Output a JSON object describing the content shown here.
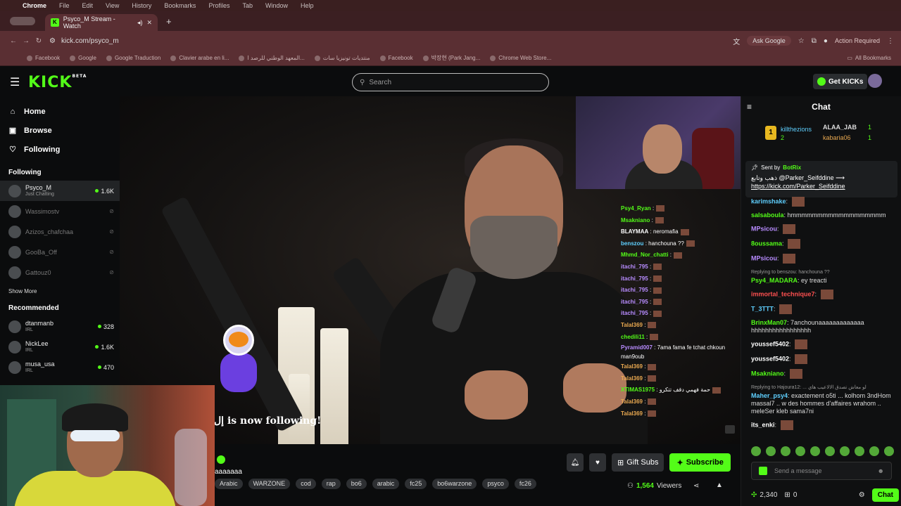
{
  "mac_menu": {
    "apple": "",
    "items": [
      "Chrome",
      "File",
      "Edit",
      "View",
      "History",
      "Bookmarks",
      "Profiles",
      "Tab",
      "Window",
      "Help"
    ]
  },
  "browser": {
    "tab_title": "Psyco_M Stream - Watch",
    "new_tab": "+",
    "url": "kick.com/psyco_m",
    "ask_google": "Ask Google",
    "action_required": "Action Required",
    "bookmarks": [
      "Facebook",
      "Google",
      "Google Traduction",
      "Clavier arabe en li...",
      "المعهد الوطني للرصد ا...",
      "منتديات تونيزيا سات",
      "Facebook",
      "박장현 (Park Jang...",
      "Chrome Web Store..."
    ],
    "all_bookmarks": "All Bookmarks"
  },
  "kick": {
    "logo": "KICK",
    "logo_badge": "BETA",
    "search_placeholder": "Search",
    "get_kicks": "Get KICKs"
  },
  "sidebar": {
    "nav": [
      {
        "label": "Home",
        "icon": "home-icon"
      },
      {
        "label": "Browse",
        "icon": "browse-icon"
      },
      {
        "label": "Following",
        "icon": "heart-icon"
      }
    ],
    "following_header": "Following",
    "following": [
      {
        "name": "Psyco_M",
        "sub": "Just Chatting",
        "viewers": "1.6K",
        "live": true
      },
      {
        "name": "Wassimostv",
        "live": false
      },
      {
        "name": "Azizos_chafchaa",
        "live": false
      },
      {
        "name": "GooBa_Off",
        "live": false
      },
      {
        "name": "Gattouz0",
        "live": false
      }
    ],
    "show_more": "Show More",
    "recommended_header": "Recommended",
    "recommended": [
      {
        "name": "dtanmanb",
        "sub": "IRL",
        "viewers": "328"
      },
      {
        "name": "NickLee",
        "sub": "IRL",
        "viewers": "1.6K"
      },
      {
        "name": "musa_usa",
        "sub": "IRL",
        "viewers": "470"
      }
    ]
  },
  "video": {
    "follow_alert": "is now following!",
    "follow_prefix": "إل",
    "overlay_chat": [
      {
        "user": "Psy4_Ryan",
        "text": ":",
        "color": "#53fc18"
      },
      {
        "user": "Msakniano",
        "text": ":",
        "color": "#53fc18"
      },
      {
        "user": "BLAYMAA",
        "text": ": neromafia",
        "color": "#ffffff"
      },
      {
        "user": "benszou",
        "text": ": hanchouna ??",
        "color": "#5fd0ff"
      },
      {
        "user": "Mhmd_Nor_chatti",
        "text": ":",
        "color": "#53fc18"
      },
      {
        "user": "itachi_795",
        "text": ":",
        "color": "#b88cff"
      },
      {
        "user": "itachi_795",
        "text": ":",
        "color": "#b88cff"
      },
      {
        "user": "itachi_795",
        "text": ":",
        "color": "#b88cff"
      },
      {
        "user": "itachi_795",
        "text": ":",
        "color": "#b88cff"
      },
      {
        "user": "itachi_795",
        "text": ":",
        "color": "#b88cff"
      },
      {
        "user": "Talal369",
        "text": ":",
        "color": "#e8a850"
      },
      {
        "user": "chedili11",
        "text": ":",
        "color": "#53fc18"
      },
      {
        "user": "Pyramid007",
        "text": ": 7ama fama fe tchat chkoun man9oub",
        "color": "#b88cff"
      },
      {
        "user": "Talal369",
        "text": ":",
        "color": "#e8a850"
      },
      {
        "user": "Talal369",
        "text": ":",
        "color": "#e8a850"
      },
      {
        "user": "XTIMAS1975",
        "text": ": حمة فهمي دقف تتكرو",
        "color": "#53fc18"
      },
      {
        "user": "Talal369",
        "text": ":",
        "color": "#e8a850"
      },
      {
        "user": "Talal369",
        "text": ":",
        "color": "#e8a850"
      }
    ]
  },
  "stream": {
    "title": "aaaaaaa",
    "tags": [
      "Arabic",
      "WARZONE",
      "cod",
      "rap",
      "bo6",
      "arabic",
      "fc25",
      "bo6warzone",
      "psyco",
      "fc26"
    ],
    "gift_subs": "Gift Subs",
    "subscribe": "Subscribe",
    "viewers": "1,564",
    "viewers_label": "Viewers"
  },
  "chat": {
    "title": "Chat",
    "leaderboard": [
      {
        "rank": "1",
        "name": "killthezions",
        "count": "2"
      },
      {
        "name": "ALAA_JAB",
        "count": "1"
      },
      {
        "name": "kabaria06",
        "count": "1"
      }
    ],
    "pinned": {
      "sent_by": "Sent by",
      "bot": "BotRix",
      "message": "ذهب وتابع @Parker_Seifddine ⟶",
      "link": "https://kick.com/Parker_Seifddine"
    },
    "messages": [
      {
        "user": "karimshake",
        "text": "",
        "color": "#5fd0ff",
        "emote": true
      },
      {
        "user": "salsaboula",
        "text": "hmmmmmmmmmmmmmmmmmm",
        "color": "#53fc18",
        "emote": false
      },
      {
        "user": "MPsicou",
        "text": "",
        "color": "#b88cff",
        "emote": true
      },
      {
        "user": "8oussama",
        "text": "",
        "color": "#53fc18",
        "emote": true
      },
      {
        "user": "MPsicou",
        "text": "",
        "color": "#b88cff",
        "emote": true
      },
      {
        "reply": "Replying to benszou: hanchouna ??",
        "user": "Psy4_MADARA",
        "text": "ey treacti",
        "color": "#53fc18",
        "emote": false
      },
      {
        "user": "immortal_technique7",
        "text": "",
        "color": "#ff5050",
        "emote": true
      },
      {
        "user": "T_3TTT",
        "text": "",
        "color": "#5fd0ff",
        "emote": true
      },
      {
        "user": "BrinxMan07",
        "text": "7anchounaaaaaaaaaaaaa hhhhhhhhhhhhhhhhh",
        "color": "#53fc18",
        "emote": false
      },
      {
        "user": "youssef5402",
        "text": "",
        "color": "#ffffff",
        "emote": true
      },
      {
        "user": "youssef5402",
        "text": "",
        "color": "#ffffff",
        "emote": true
      },
      {
        "user": "Msakniano",
        "text": "",
        "color": "#53fc18",
        "emote": true
      },
      {
        "reply": "Replying to Hajoura12: ... لو معاش تصدق الالاعيب هاي",
        "user": "Maher_psy4",
        "text": "exactement o5ti ... kolhom 3ndHom massal7 .. w des hommes d'affaires wrahom .. meleSer kleb sama7ni",
        "color": "#5fd0ff",
        "emote": false
      },
      {
        "user": "its_enki",
        "text": "",
        "color": "#ffffff",
        "emote": true
      }
    ],
    "input_placeholder": "Send a message",
    "points": "2,340",
    "gifts": "0",
    "chat_button": "Chat"
  }
}
